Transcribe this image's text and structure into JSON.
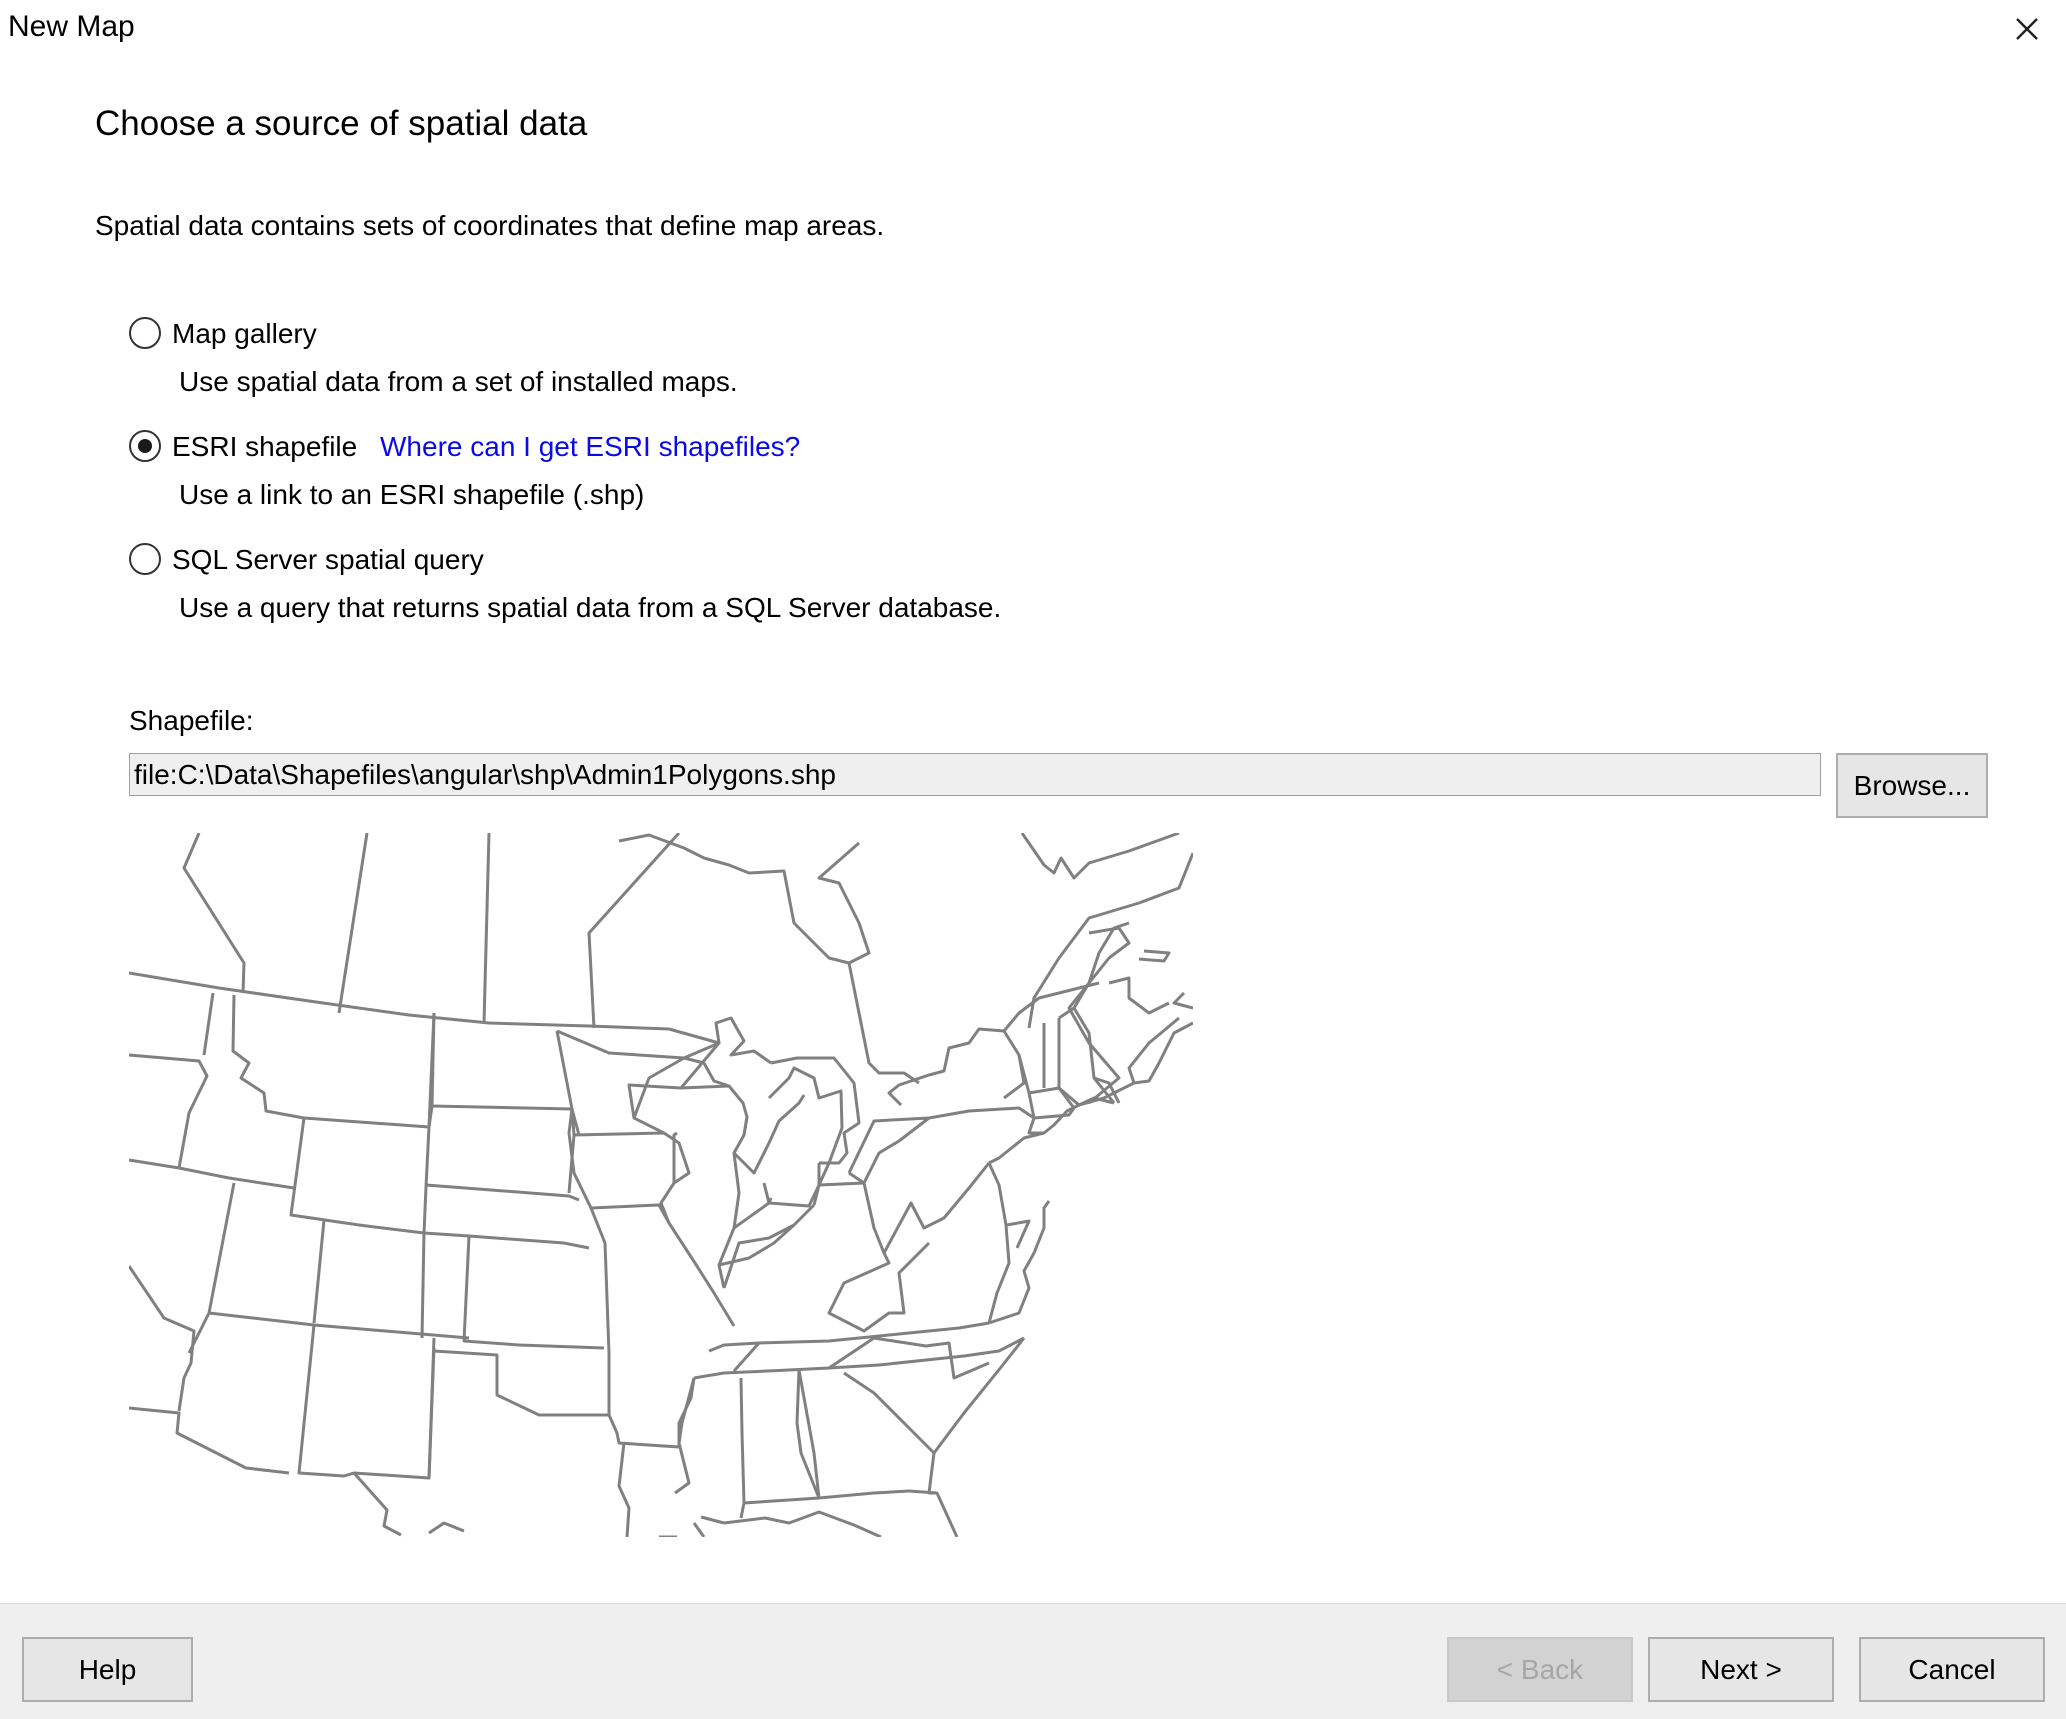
{
  "window": {
    "title": "New Map",
    "close_icon": "close-icon"
  },
  "wizard": {
    "heading": "Choose a source of spatial data",
    "intro": "Spatial data contains sets of coordinates that define map areas."
  },
  "options": [
    {
      "label": "Map gallery",
      "description": "Use spatial data from a set of installed maps.",
      "checked": false
    },
    {
      "label": "ESRI shapefile",
      "description": "Use a link to an ESRI shapefile (.shp)",
      "checked": true,
      "link": "Where can I get ESRI shapefiles?"
    },
    {
      "label": "SQL Server spatial query",
      "description": "Use a query that returns spatial data from a SQL Server database.",
      "checked": false
    }
  ],
  "shapefile": {
    "label": "Shapefile:",
    "value": "file:C:\\Data\\Shapefiles\\angular\\shp\\Admin1Polygons.shp",
    "browse_label": "Browse..."
  },
  "footer": {
    "help_label": "Help",
    "back_label": "< Back",
    "next_label": "Next >",
    "cancel_label": "Cancel"
  },
  "colors": {
    "link": "#0a0ae6",
    "map_stroke": "#808080",
    "footer_bg": "#efefef"
  }
}
